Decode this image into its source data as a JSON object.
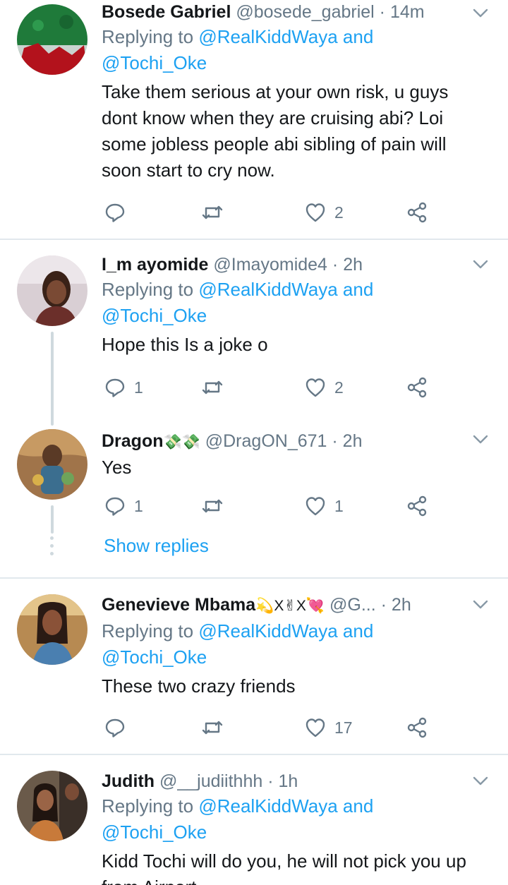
{
  "replying_prefix": "Replying to",
  "mention_primary": "@RealKiddWaya and",
  "mention_secondary": "@Tochi_Oke",
  "show_replies_label": "Show replies",
  "colors": {
    "accent": "#1da1f2",
    "secondary_text": "#657786",
    "divider": "#e1e8ed",
    "text": "#14171a"
  },
  "icons": [
    "reply-icon",
    "retweet-icon",
    "like-icon",
    "share-icon",
    "chevron-down-icon"
  ],
  "tweets": [
    {
      "name": "Bosede Gabriel",
      "handle": "@bosede_gabriel",
      "time": "· 14m",
      "text": "Take them serious at your own risk, u guys dont know when they are cruising abi? Loi some jobless people abi sibling of pain will soon start to cry now.",
      "replies": "",
      "likes": "2"
    },
    {
      "name": "I_m ayomide",
      "handle": "@Imayomide4",
      "time": "· 2h",
      "text": "Hope this Is a joke o",
      "replies": "1",
      "likes": "2"
    },
    {
      "name": "Dragon",
      "name_emoji": "💸💸",
      "handle": "@DragON_671",
      "time": "· 2h",
      "text": "Yes",
      "replies": "1",
      "likes": "1"
    },
    {
      "name": "Genevieve Mbama",
      "name_emoji": "💫X✌X💘",
      "handle": "@G...",
      "time": "· 2h",
      "text": "These two crazy friends",
      "replies": "",
      "likes": "17"
    },
    {
      "name": "Judith",
      "handle": "@__judiithhh",
      "time": "· 1h",
      "text": "Kidd Tochi will do you, he will not pick you up from Airport",
      "replies": "",
      "likes": ""
    }
  ]
}
